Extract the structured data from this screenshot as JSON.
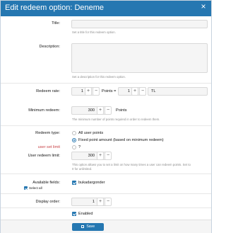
{
  "dialog": {
    "title": "Edit redeem option: Deneme",
    "close_icon": "×"
  },
  "fields": {
    "title": {
      "label": "Title:",
      "hint": "Set a title for this redeem option."
    },
    "description": {
      "label": "Description:",
      "hint": "Set a description for this redeem option."
    },
    "redeem_rate": {
      "label": "Redeem rate:",
      "points_value": "1",
      "points_label": "Points =",
      "currency_value": "1",
      "currency_label": "TL"
    },
    "minimum_redeem": {
      "label": "Minimum redeem:",
      "value": "300",
      "unit": "Points",
      "hint": "The minimum number of points required in order to redeem them."
    },
    "redeem_type": {
      "label": "Redeem type:",
      "options": [
        "All user points",
        "Fixed point amount (based on minimum redeem)"
      ],
      "selected": "Fixed point amount (based on minimum redeem)"
    },
    "user_set_limit": {
      "label": "user set limit",
      "value": "?"
    },
    "user_redeem_limit": {
      "label": "User redeem limit:",
      "value": "300",
      "hint_line1": "This option allows you to set a limit on how many times a user can redeem points. Set to",
      "hint_line2": "0 for unlimited."
    },
    "available_fields": {
      "label": "Available fields:",
      "select_all": "Select all",
      "item": "bukadargonder"
    },
    "display_order": {
      "label": "Display order:",
      "value": "1"
    },
    "enabled": {
      "label": "Enabled"
    }
  },
  "actions": {
    "save_label": "Save"
  }
}
